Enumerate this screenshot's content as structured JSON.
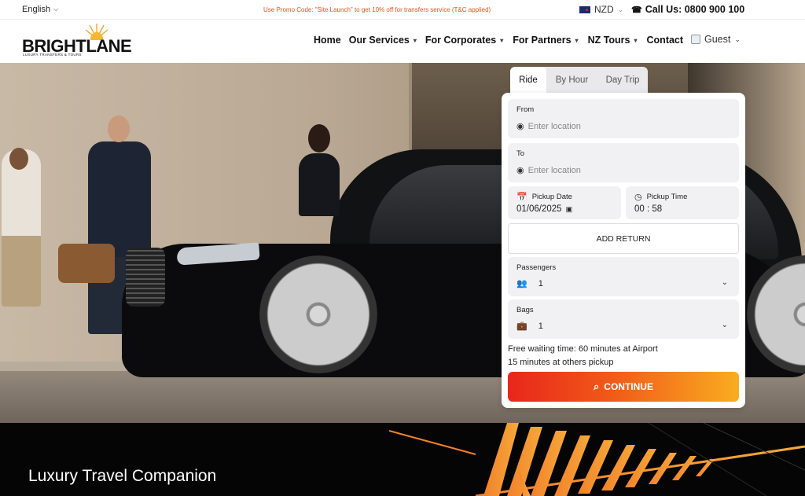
{
  "topbar": {
    "language": "English",
    "promo": "Use Promo Code: \"Site Launch\" to get 10% off for transfers service (T&C applied)",
    "currency": "NZD",
    "call": "Call Us: 0800 900 100"
  },
  "brand": {
    "logo_text": "BRIGHTLANE",
    "logo_sub": "LUXURY TRANSFERS & TOURS"
  },
  "nav": {
    "items": [
      {
        "label": "Home",
        "dropdown": false
      },
      {
        "label": "Our Services",
        "dropdown": true
      },
      {
        "label": "For Corporates",
        "dropdown": true
      },
      {
        "label": "For Partners",
        "dropdown": true
      },
      {
        "label": "NZ Tours",
        "dropdown": true
      },
      {
        "label": "Contact",
        "dropdown": false
      }
    ],
    "guest": "Guest"
  },
  "booking": {
    "tabs": [
      "Ride",
      "By Hour",
      "Day Trip"
    ],
    "active_tab": "Ride",
    "from": {
      "label": "From",
      "placeholder": "Enter location"
    },
    "to": {
      "label": "To",
      "placeholder": "Enter location"
    },
    "pickup_date": {
      "label": "Pickup Date",
      "value": "01/06/2025"
    },
    "pickup_time": {
      "label": "Pickup Time",
      "value": "00 : 58"
    },
    "add_return": "ADD RETURN",
    "passengers": {
      "label": "Passengers",
      "value": "1"
    },
    "bags": {
      "label": "Bags",
      "value": "1"
    },
    "waiting_line1": "Free waiting time: 60 minutes at Airport",
    "waiting_line2": "15 minutes at others pickup",
    "continue": "CONTINUE"
  },
  "bottom": {
    "title": "Luxury Travel Companion"
  },
  "colors": {
    "accent_start": "#e8261b",
    "accent_end": "#f9ad20",
    "promo": "#e8541c"
  }
}
